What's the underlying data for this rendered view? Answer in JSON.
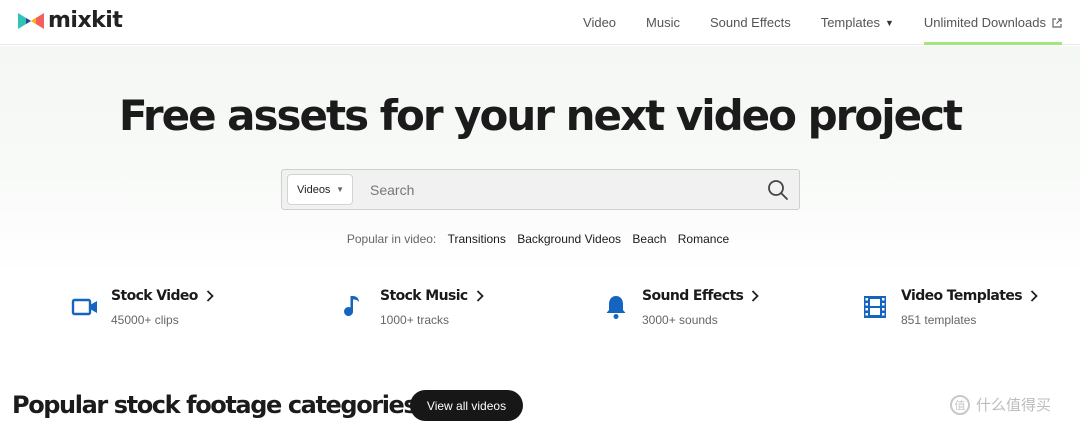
{
  "brand": {
    "name": "mixkit",
    "colors": {
      "accent": "#a4e67c",
      "icon_blue": "#1565c0"
    }
  },
  "nav": {
    "items": [
      {
        "label": "Video"
      },
      {
        "label": "Music"
      },
      {
        "label": "Sound Effects"
      },
      {
        "label": "Templates",
        "has_dropdown": true
      },
      {
        "label": "Unlimited Downloads",
        "external": true,
        "active": true
      }
    ]
  },
  "hero": {
    "title": "Free assets for your next video project",
    "search": {
      "type_selected": "Videos",
      "placeholder": "Search",
      "value": ""
    },
    "popular": {
      "label": "Popular in video:",
      "links": [
        "Transitions",
        "Background Videos",
        "Beach",
        "Romance"
      ]
    }
  },
  "categories": [
    {
      "title": "Stock Video",
      "subtitle": "45000+ clips",
      "icon": "video-camera-icon"
    },
    {
      "title": "Stock Music",
      "subtitle": "1000+ tracks",
      "icon": "music-note-icon"
    },
    {
      "title": "Sound Effects",
      "subtitle": "3000+ sounds",
      "icon": "bell-icon"
    },
    {
      "title": "Video Templates",
      "subtitle": "851 templates",
      "icon": "film-strip-icon"
    }
  ],
  "section": {
    "title": "Popular stock footage categories",
    "view_all_label": "View all videos"
  },
  "watermark": {
    "text": "什么值得买",
    "icon_char": "值"
  }
}
